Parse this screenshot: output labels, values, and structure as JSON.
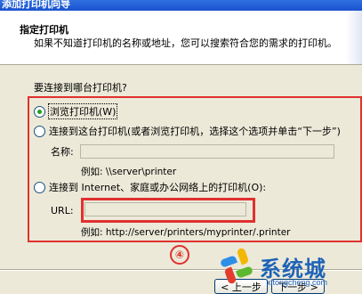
{
  "window": {
    "title": "添加打印机向导"
  },
  "header": {
    "title": "指定打印机",
    "subtitle": "如果不知道打印机的名称或地址，您可以搜索符合您的需求的打印机。"
  },
  "question": "要连接到哪台打印机?",
  "options": [
    {
      "label": "浏览打印机(W)",
      "selected": true
    },
    {
      "label": "连接到这台打印机(或者浏览打印机，选择这个选项并单击“下一步”)",
      "selected": false
    },
    {
      "label": "连接到 Internet、家庭或办公网络上的打印机(O):",
      "selected": false
    }
  ],
  "name_field": {
    "label": "名称:",
    "value": "",
    "example": "例如: \\\\server\\printer"
  },
  "url_field": {
    "label": "URL:",
    "value": "",
    "example": "例如: http://server/printers/myprinter/.printer"
  },
  "annotation": {
    "step": "④",
    "color": "#e0312f"
  },
  "buttons": {
    "back": "< 上一步",
    "next": "下一步 >"
  },
  "watermark": {
    "text": "系统城",
    "sub": "xitongcheng.com"
  },
  "colors": {
    "title_bar": "#1a52cf",
    "highlight": "#e0312f",
    "radio_dot": "#21a121"
  }
}
